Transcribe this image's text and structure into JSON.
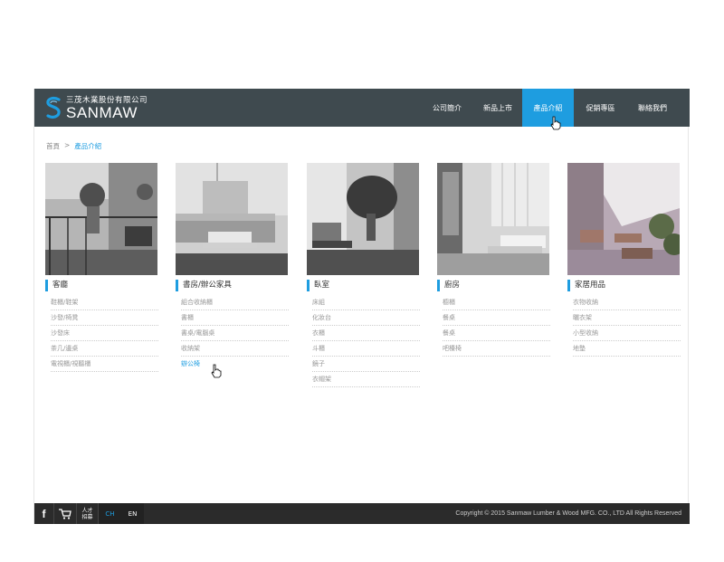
{
  "header": {
    "logo_cn": "三茂木業股份有限公司",
    "logo_en": "SANMAW",
    "nav": [
      {
        "label": "公司簡介",
        "active": false
      },
      {
        "label": "新品上市",
        "active": false
      },
      {
        "label": "產品介紹",
        "active": true
      },
      {
        "label": "促銷專區",
        "active": false
      },
      {
        "label": "聯絡我們",
        "active": false
      }
    ]
  },
  "breadcrumb": {
    "home": "首頁",
    "separator": ">",
    "current": "產品介紹"
  },
  "categories": [
    {
      "title": "客廳",
      "items": [
        "鞋櫃/鞋架",
        "沙發/椅凳",
        "沙發床",
        "茶几/邊桌",
        "電視櫃/視聽櫃"
      ]
    },
    {
      "title": "書房/辦公家具",
      "items": [
        "組合收納櫃",
        "書櫃",
        "書桌/電腦桌",
        "收納架",
        "辦公椅"
      ]
    },
    {
      "title": "臥室",
      "items": [
        "床組",
        "化妝台",
        "衣櫃",
        "斗櫃",
        "鏡子",
        "衣帽架"
      ]
    },
    {
      "title": "廚房",
      "items": [
        "櫥櫃",
        "餐桌",
        "餐桌",
        "吧檯椅"
      ]
    },
    {
      "title": "家居用品",
      "items": [
        "衣物收納",
        "曬衣架",
        "小型收納",
        "地墊"
      ]
    }
  ],
  "footer": {
    "jobs_line1": "人才",
    "jobs_line2": "招募",
    "lang_ch": "CH",
    "lang_en": "EN",
    "copyright": "Copyright © 2015 Sanmaw Lumber & Wood MFG. CO., LTD All Rights Reserved"
  },
  "colors": {
    "header_bg": "#3f4a4f",
    "accent": "#1e9de0",
    "footer_bg": "#2b2b2b"
  }
}
